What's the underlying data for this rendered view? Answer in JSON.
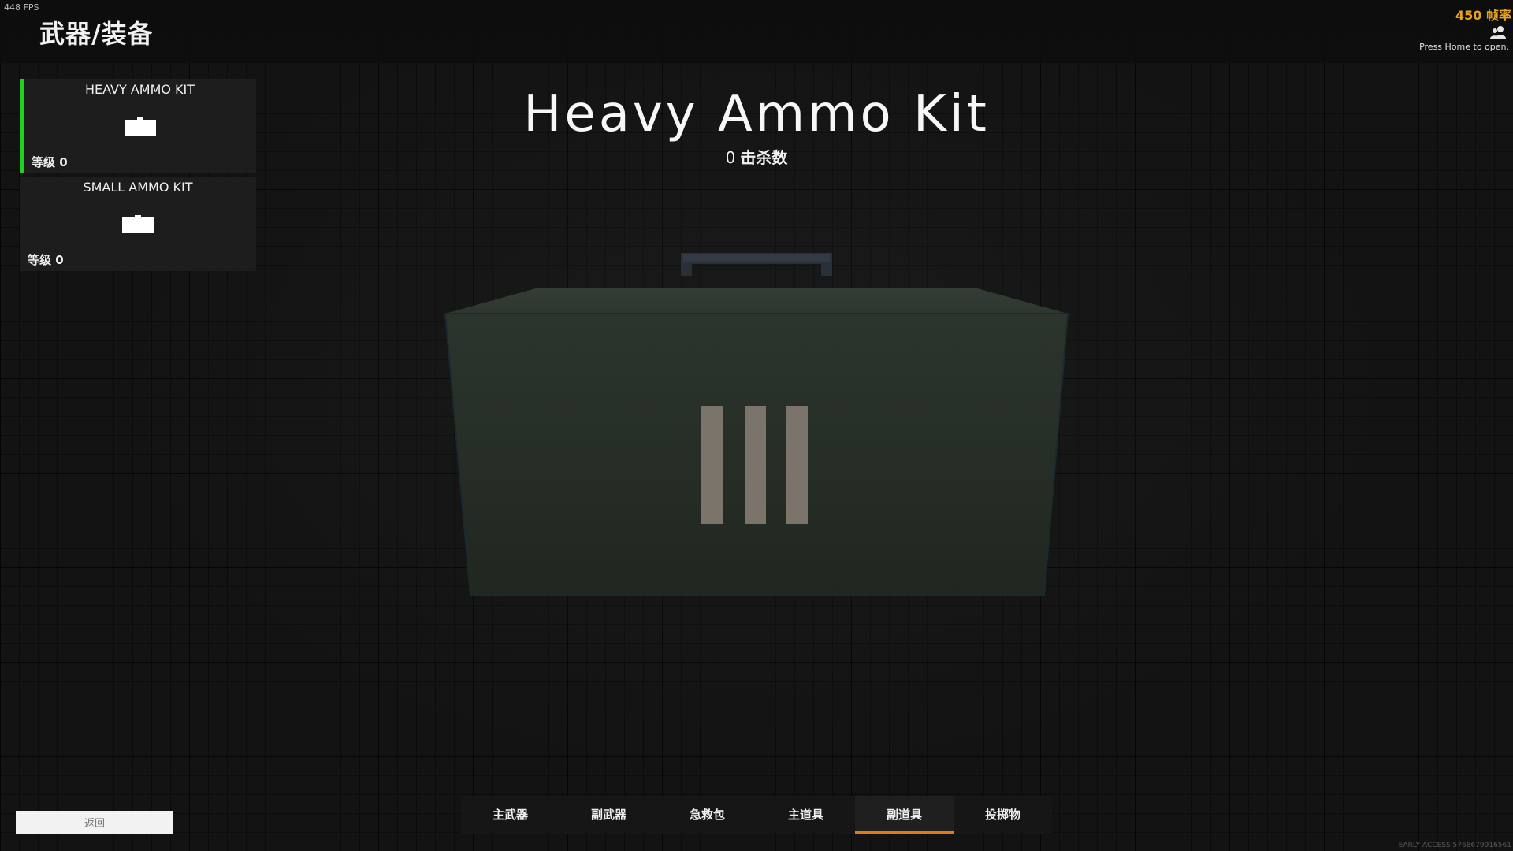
{
  "hud": {
    "fps_left": "448 FPS",
    "fps_right": "450 帧率",
    "friends_hint": "Press Home to open."
  },
  "header": {
    "title": "武器/装备"
  },
  "item_list": [
    {
      "name": "HEAVY AMMO KIT",
      "level": "等级 0",
      "selected": true
    },
    {
      "name": "SMALL AMMO KIT",
      "level": "等级 0",
      "selected": false
    }
  ],
  "display": {
    "item_title": "Heavy Ammo Kit",
    "kills_value": "0",
    "kills_label": "击杀数"
  },
  "category_tabs": [
    {
      "label": "主武器",
      "active": false
    },
    {
      "label": "副武器",
      "active": false
    },
    {
      "label": "急救包",
      "active": false
    },
    {
      "label": "主道具",
      "active": false
    },
    {
      "label": "副道具",
      "active": true
    },
    {
      "label": "投掷物",
      "active": false
    }
  ],
  "footer": {
    "back_label": "返回",
    "build_label": "EARLY ACCESS 5768679916561"
  },
  "colors": {
    "selected_accent": "#1ed21e",
    "active_tab_accent": "#e47a16",
    "fps_highlight": "#e9a21b",
    "box_body": "#293129"
  },
  "icons": {
    "friends": "friends-icon",
    "item_thumbnail": "ammo-box-icon"
  }
}
